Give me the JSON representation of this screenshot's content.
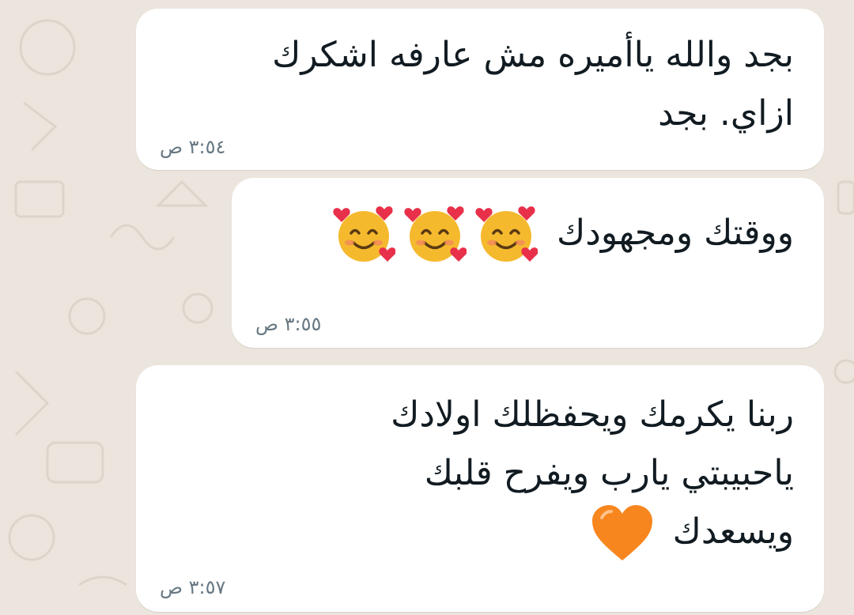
{
  "chat": {
    "messages": [
      {
        "lines": [
          "بجد والله ياأميره مش عارفه اشكرك",
          "ازاي. بجد"
        ],
        "time": "٣:٥٤ ص"
      },
      {
        "text": "ووقتك ومجهودك",
        "emojis": [
          "smiling-face-with-hearts-icon",
          "smiling-face-with-hearts-icon",
          "smiling-face-with-hearts-icon"
        ],
        "time": "٣:٥٥ ص"
      },
      {
        "lines": [
          "ربنا يكرمك ويحفظلك اولادك",
          "ياحبيبتي يارب ويفرح قلبك",
          "ويسعدك"
        ],
        "emoji": "orange-heart-icon",
        "time": "٣:٥٧ ص"
      }
    ]
  },
  "colors": {
    "background": "#ece5dd",
    "bubble": "#ffffff",
    "text": "#111b21",
    "timestamp": "#667781",
    "heart": "#f7861f"
  }
}
